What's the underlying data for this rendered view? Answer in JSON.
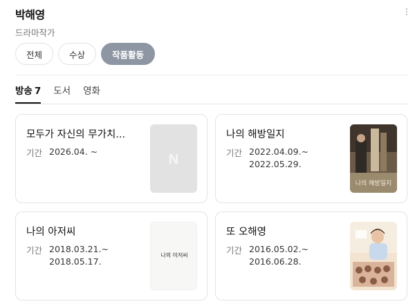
{
  "profile": {
    "name": "박해영",
    "job": "드라마작가"
  },
  "filters": [
    {
      "label": "전체",
      "active": false
    },
    {
      "label": "수상",
      "active": false
    },
    {
      "label": "작품활동",
      "active": true
    }
  ],
  "tabs": [
    {
      "label": "방송",
      "count": "7",
      "active": true
    },
    {
      "label": "도서",
      "count": "",
      "active": false
    },
    {
      "label": "영화",
      "count": "",
      "active": false
    }
  ],
  "works": [
    {
      "title": "모두가 자신의 무가치...",
      "period_label": "기간",
      "date_start": "2026.04. ~",
      "date_end": "",
      "thumb_text": "N"
    },
    {
      "title": "나의 해방일지",
      "period_label": "기간",
      "date_start": "2022.04.09.~",
      "date_end": "2022.05.29.",
      "thumb_text": "나의 해방일지"
    },
    {
      "title": "나의 아저씨",
      "period_label": "기간",
      "date_start": "2018.03.21.~",
      "date_end": "2018.05.17.",
      "thumb_text": "나의 아저씨"
    },
    {
      "title": "또 오해영",
      "period_label": "기간",
      "date_start": "2016.05.02.~",
      "date_end": "2016.06.28.",
      "thumb_text": ""
    }
  ],
  "colors": {
    "active_chip": "#8e96a3",
    "placeholder_thumb": "#e2e2e2"
  }
}
